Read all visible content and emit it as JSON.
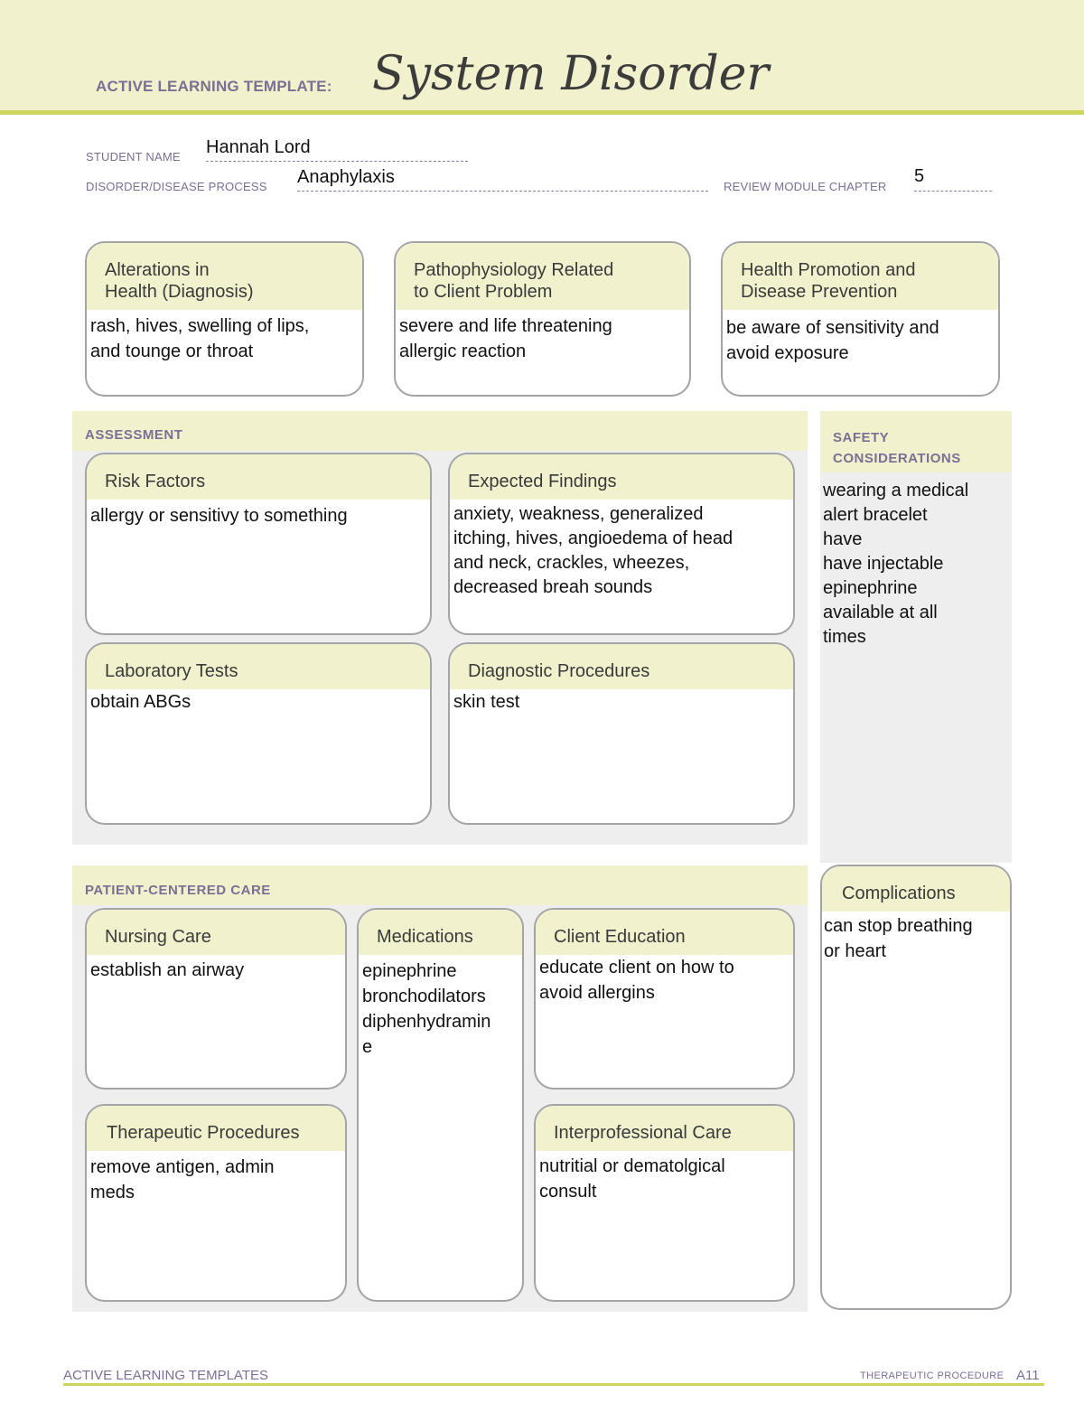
{
  "header": {
    "label": "ACTIVE LEARNING TEMPLATE:",
    "title": "System Disorder"
  },
  "fields": {
    "student_name_label": "STUDENT NAME",
    "student_name_value": "Hannah Lord",
    "disorder_label": "DISORDER/DISEASE PROCESS",
    "disorder_value": "Anaphylaxis",
    "chapter_label": "REVIEW MODULE CHAPTER",
    "chapter_value": "5"
  },
  "top_boxes": [
    {
      "title": "Alterations in\nHealth (Diagnosis)",
      "body": "rash, hives, swelling of lips,\nand tounge or throat"
    },
    {
      "title": "Pathophysiology Related\nto Client Problem",
      "body": " severe and life threatening\nallergic reaction"
    },
    {
      "title": "Health Promotion and\nDisease Prevention",
      "body": "be aware of sensitivity and\navoid exposure"
    }
  ],
  "assessment": {
    "title": "ASSESSMENT",
    "boxes": [
      {
        "title": "Risk Factors",
        "body": "allergy or sensitivy to something"
      },
      {
        "title": "Expected Findings",
        "body": "anxiety, weakness, generalized\nitching, hives, angioedema of head\nand neck, crackles, wheezes,\ndecreased breah sounds"
      },
      {
        "title": "Laboratory Tests",
        "body": "obtain ABGs"
      },
      {
        "title": "Diagnostic Procedures",
        "body": "skin test"
      }
    ]
  },
  "safety": {
    "title": "SAFETY\nCONSIDERATIONS",
    "body": "wearing a medical\nalert bracelet\nhave\nhave injectable\nepinephrine\navailable at all\ntimes"
  },
  "patient_care": {
    "title": "PATIENT-CENTERED CARE",
    "boxes": [
      {
        "title": "Nursing Care",
        "body": "establish an airway"
      },
      {
        "title": "Medications",
        "body": "epinephrine\nbronchodilators\ndiphenhydramin\ne"
      },
      {
        "title": "Client Education",
        "body": "educate client on how to\navoid allergins"
      },
      {
        "title": "Therapeutic Procedures",
        "body": "remove antigen, admin\nmeds"
      },
      {
        "title": "Interprofessional Care",
        "body": "nutritial or dematolgical\nconsult"
      }
    ]
  },
  "complications": {
    "title": "Complications",
    "body": "can stop breathing\nor heart"
  },
  "footer": {
    "left": "ACTIVE LEARNING TEMPLATES",
    "right": "THERAPEUTIC PROCEDURE",
    "page": "A11"
  }
}
